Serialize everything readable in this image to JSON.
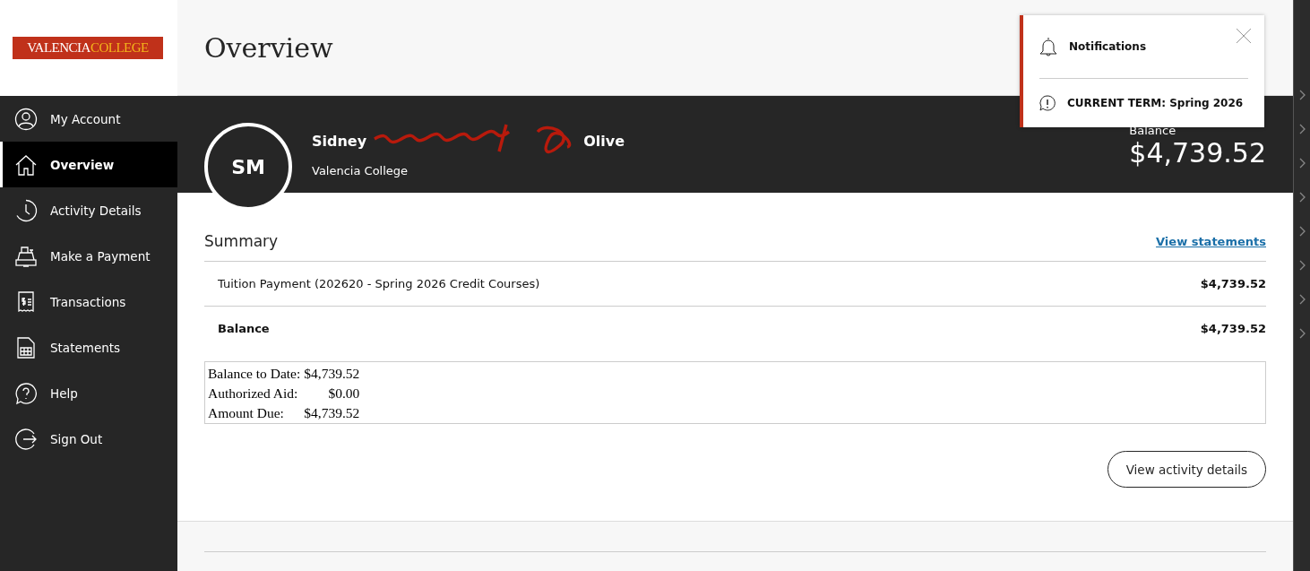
{
  "logo": {
    "first": "VALENCIA",
    "second": "COLLEGE"
  },
  "sidebar": {
    "items": [
      {
        "label": "My Account",
        "selected": false
      },
      {
        "label": "Overview",
        "selected": true
      },
      {
        "label": "Activity Details",
        "selected": false
      },
      {
        "label": "Make a Payment",
        "selected": false
      },
      {
        "label": "Transactions",
        "selected": false
      },
      {
        "label": "Statements",
        "selected": false
      },
      {
        "label": "Help",
        "selected": false
      },
      {
        "label": "Sign Out",
        "selected": false
      }
    ]
  },
  "page_title": "Overview",
  "account": {
    "initials": "SM",
    "name_start": "Sidney",
    "name_end": "Olive",
    "institution": "Valencia College",
    "balance_label": "Balance",
    "balance": "$4,739.52"
  },
  "notifications": {
    "title": "Notifications",
    "items": [
      "CURRENT TERM: Spring 2026"
    ]
  },
  "summary": {
    "title": "Summary",
    "link": "View statements",
    "rows": [
      {
        "label": "Tuition Payment (202620 - Spring 2026 Credit Courses)",
        "amount": "$4,739.52",
        "bold": false
      },
      {
        "label": "Balance",
        "amount": "$4,739.52",
        "bold": true
      }
    ],
    "details": [
      {
        "label": "Balance to Date:",
        "value": "$4,739.52"
      },
      {
        "label": "Authorized Aid:",
        "value": "$0.00"
      },
      {
        "label": "Amount Due:",
        "value": "$4,739.52"
      }
    ],
    "button": "View activity details"
  }
}
